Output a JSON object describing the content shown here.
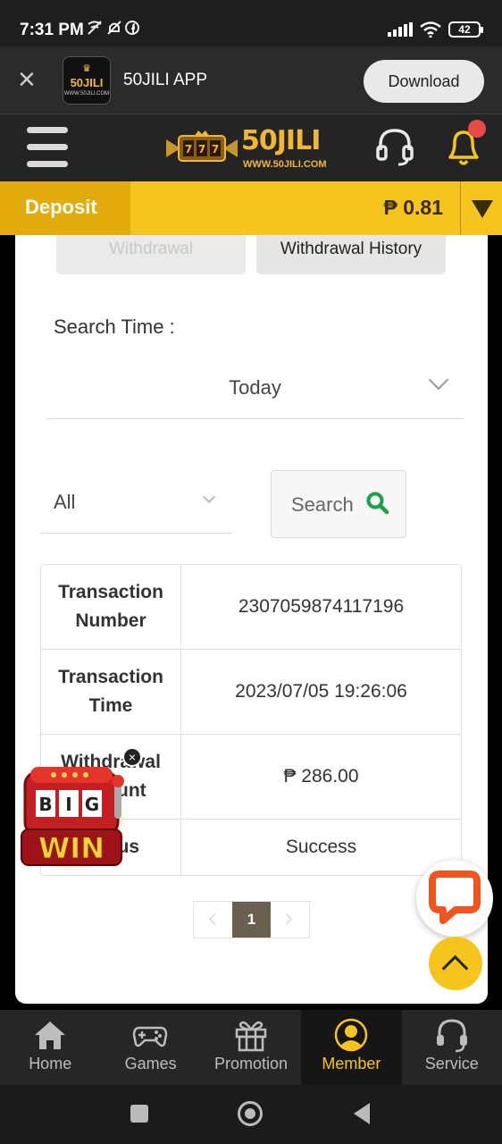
{
  "status_bar": {
    "time": "7:31 PM",
    "battery": "42",
    "icons": [
      "wifi-calling-icon",
      "mute-icon",
      "facebook-icon",
      "signal-icon",
      "wifi-icon",
      "battery-icon"
    ]
  },
  "app_banner": {
    "logo_text": "50JILI",
    "logo_url": "WWW.50JILI.COM",
    "title": "50JILI APP",
    "download_label": "Download"
  },
  "header": {
    "logo_text": "50JILI",
    "logo_url": "WWW.50JILI.COM"
  },
  "deposit_bar": {
    "deposit_label": "Deposit",
    "balance": "₱ 0.81"
  },
  "tabs": [
    {
      "label": "Withdrawal",
      "active": false
    },
    {
      "label": "Withdrawal History",
      "active": true
    }
  ],
  "filters": {
    "search_time_label": "Search Time :",
    "time_value": "Today",
    "status_value": "All",
    "search_label": "Search"
  },
  "transaction": {
    "rows": [
      {
        "key": "Transaction Number",
        "value": "2307059874117196"
      },
      {
        "key": "Transaction Time",
        "value": "2023/07/05 19:26:06"
      },
      {
        "key": "Withdrawal Amount",
        "value": "₱ 286.00"
      },
      {
        "key": "Status",
        "value": "Success"
      }
    ]
  },
  "pagination": {
    "current": "1"
  },
  "promo": {
    "line1": "BIG",
    "line2": "WIN"
  },
  "bottom_nav": [
    {
      "label": "Home",
      "icon": "home-icon",
      "active": false
    },
    {
      "label": "Games",
      "icon": "gamepad-icon",
      "active": false
    },
    {
      "label": "Promotion",
      "icon": "gift-icon",
      "active": false
    },
    {
      "label": "Member",
      "icon": "member-icon",
      "active": true
    },
    {
      "label": "Service",
      "icon": "headset-icon",
      "active": false
    }
  ],
  "colors": {
    "accent_yellow": "#f6c51d",
    "deposit_button": "#e3ab0b",
    "header_bg": "#242424",
    "success_green": "#1aa34a",
    "chat_orange": "#f0551f"
  }
}
